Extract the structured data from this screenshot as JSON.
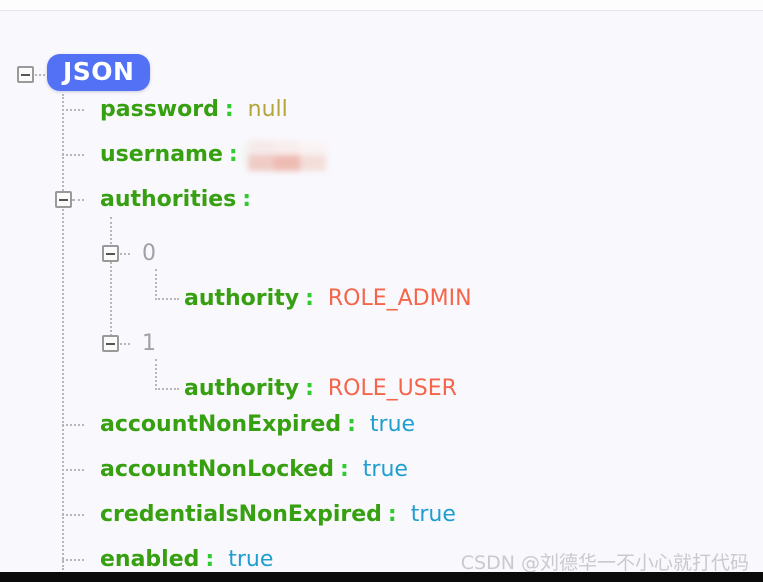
{
  "viewer": {
    "root_badge": "JSON",
    "accent_badge_color": "#5271f5",
    "background_color": "#f9f8fd",
    "key_color": "#36a010",
    "string_value_color": "#f4654a",
    "boolean_value_color": "#1e9fd0",
    "null_value_color": "#b3a53a",
    "index_color": "#a0a0a8"
  },
  "tree": {
    "password": {
      "key": "password",
      "colon": ":",
      "value": "null"
    },
    "username": {
      "key": "username",
      "colon": ":",
      "value": ""
    },
    "authorities": {
      "key": "authorities",
      "colon": ":"
    },
    "authorities_items": [
      {
        "index": "0",
        "authority": {
          "key": "authority",
          "colon": ":",
          "value": "ROLE_ADMIN"
        }
      },
      {
        "index": "1",
        "authority": {
          "key": "authority",
          "colon": ":",
          "value": "ROLE_USER"
        }
      }
    ],
    "accountNonExpired": {
      "key": "accountNonExpired",
      "colon": ":",
      "value": "true"
    },
    "accountNonLocked": {
      "key": "accountNonLocked",
      "colon": ":",
      "value": "true"
    },
    "credentialsNonExpired": {
      "key": "credentialsNonExpired",
      "colon": ":",
      "value": "true"
    },
    "enabled": {
      "key": "enabled",
      "colon": ":",
      "value": "true"
    }
  },
  "watermark": {
    "text": "CSDN @刘德华一不小心就打代码"
  }
}
